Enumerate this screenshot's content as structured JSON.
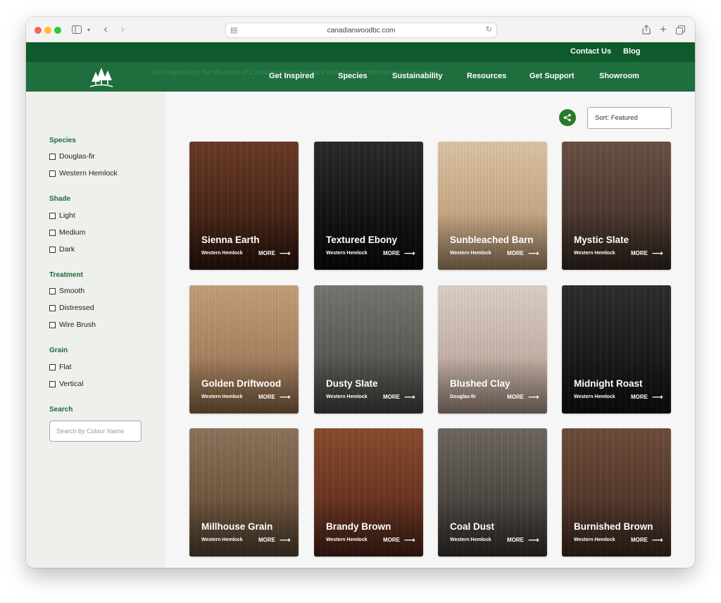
{
  "browser": {
    "url": "canadianwoodbc.com"
  },
  "header": {
    "top_links": [
      "Contact Us",
      "Blog"
    ],
    "ghost_text": "Get inspired by the diversity of Canadian wood finishes and discover the story of our forests",
    "nav": [
      "Get Inspired",
      "Species",
      "Sustainability",
      "Resources",
      "Get Support",
      "Showroom"
    ]
  },
  "sidebar": {
    "groups": [
      {
        "heading": "Species",
        "options": [
          "Douglas-fir",
          "Western Hemlock"
        ]
      },
      {
        "heading": "Shade",
        "options": [
          "Light",
          "Medium",
          "Dark"
        ]
      },
      {
        "heading": "Treatment",
        "options": [
          "Smooth",
          "Distressed",
          "Wire Brush"
        ]
      },
      {
        "heading": "Grain",
        "options": [
          "Flat",
          "Vertical"
        ]
      }
    ],
    "search_heading": "Search",
    "search_placeholder": "Search by Colour Name"
  },
  "toolbar": {
    "sort_label": "Sort: Featured"
  },
  "more_label": "MORE",
  "products": [
    {
      "name": "Sienna Earth",
      "species": "Western Hemlock",
      "colors": [
        "#6b3a26",
        "#4a2618",
        "#2e170f"
      ]
    },
    {
      "name": "Textured Ebony",
      "species": "Western Hemlock",
      "colors": [
        "#2b2b2b",
        "#141414",
        "#0b0b0b"
      ]
    },
    {
      "name": "Sunbleached Barn",
      "species": "Western Hemlock",
      "colors": [
        "#dcc4a4",
        "#c8a985",
        "#a98a6a"
      ]
    },
    {
      "name": "Mystic Slate",
      "species": "Western Hemlock",
      "colors": [
        "#6a5044",
        "#4e3a31",
        "#35281f"
      ]
    },
    {
      "name": "Golden Driftwood",
      "species": "Western Hemlock",
      "colors": [
        "#c4a07a",
        "#a98360",
        "#8a6848"
      ]
    },
    {
      "name": "Dusty Slate",
      "species": "Western Hemlock",
      "colors": [
        "#77756f",
        "#5c5a55",
        "#45433f"
      ]
    },
    {
      "name": "Blushed Clay",
      "species": "Douglas-fir",
      "colors": [
        "#ddd0c8",
        "#c6b3a8",
        "#a89286"
      ]
    },
    {
      "name": "Midnight Roast",
      "species": "Western Hemlock",
      "colors": [
        "#2e2d2e",
        "#1c1b1c",
        "#121112"
      ]
    },
    {
      "name": "Millhouse Grain",
      "species": "Western Hemlock",
      "colors": [
        "#8e735c",
        "#70573f",
        "#554230"
      ]
    },
    {
      "name": "Brandy Brown",
      "species": "Western Hemlock",
      "colors": [
        "#8a4c2e",
        "#6b3420",
        "#4a2418"
      ]
    },
    {
      "name": "Coal Dust",
      "species": "Western Hemlock",
      "colors": [
        "#6e6760",
        "#4e4843",
        "#38332f"
      ]
    },
    {
      "name": "Burnished Brown",
      "species": "Western Hemlock",
      "colors": [
        "#6e4c3a",
        "#54392b",
        "#3d2a20"
      ]
    }
  ]
}
